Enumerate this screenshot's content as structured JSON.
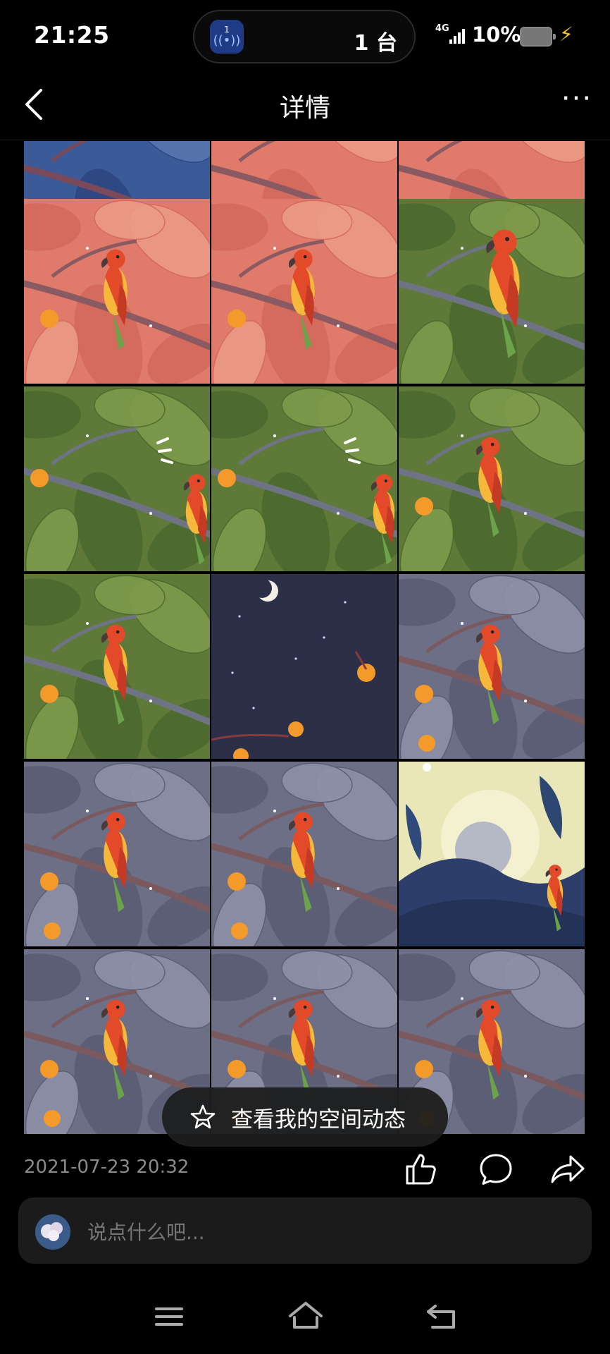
{
  "status_bar": {
    "time": "21:25",
    "pill_badge": "1",
    "pill_count": "1 台",
    "network": "4G",
    "battery_percent": "10%"
  },
  "header": {
    "title": "详情"
  },
  "gallery": {
    "cells": [
      {
        "scene": "blue-partial"
      },
      {
        "scene": "pink-partial"
      },
      {
        "scene": "pink-partial"
      },
      {
        "scene": "pink-parrot"
      },
      {
        "scene": "pink-parrot"
      },
      {
        "scene": "green-parrot-large"
      },
      {
        "scene": "green-partial-parrot"
      },
      {
        "scene": "green-partial-parrot"
      },
      {
        "scene": "green-parrot"
      },
      {
        "scene": "green-parrot"
      },
      {
        "scene": "night-sky"
      },
      {
        "scene": "gray-parrot"
      },
      {
        "scene": "gray-parrot"
      },
      {
        "scene": "gray-parrot"
      },
      {
        "scene": "yellow-moon"
      },
      {
        "scene": "gray-parrot"
      },
      {
        "scene": "gray-parrot"
      },
      {
        "scene": "gray-parrot"
      }
    ],
    "floating_button_label": "查看我的空间动态"
  },
  "post": {
    "timestamp": "2021-07-23 20:32"
  },
  "comment_box": {
    "placeholder": "说点什么吧..."
  },
  "colors": {
    "background": "#000000",
    "accent_battery": "#f4c21a"
  }
}
